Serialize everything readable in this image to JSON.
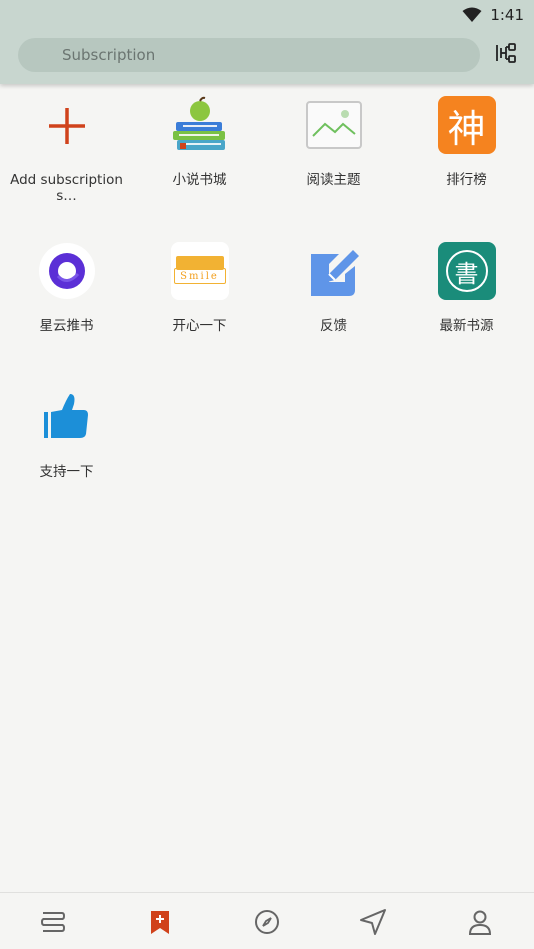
{
  "status": {
    "time": "1:41"
  },
  "search": {
    "placeholder": "Subscription"
  },
  "items": [
    {
      "label": "Add subscription s…"
    },
    {
      "label": "小说书城"
    },
    {
      "label": "阅读主题"
    },
    {
      "label": "排行榜",
      "icon_text": "神"
    },
    {
      "label": "星云推书"
    },
    {
      "label": "开心一下",
      "icon_text": "Smile"
    },
    {
      "label": "反馈"
    },
    {
      "label": "最新书源",
      "icon_text": "書"
    },
    {
      "label": "支持一下"
    }
  ],
  "colors": {
    "accent": "#d0421b",
    "topbar": "#c8d6cf",
    "background": "#f5f5f3"
  }
}
